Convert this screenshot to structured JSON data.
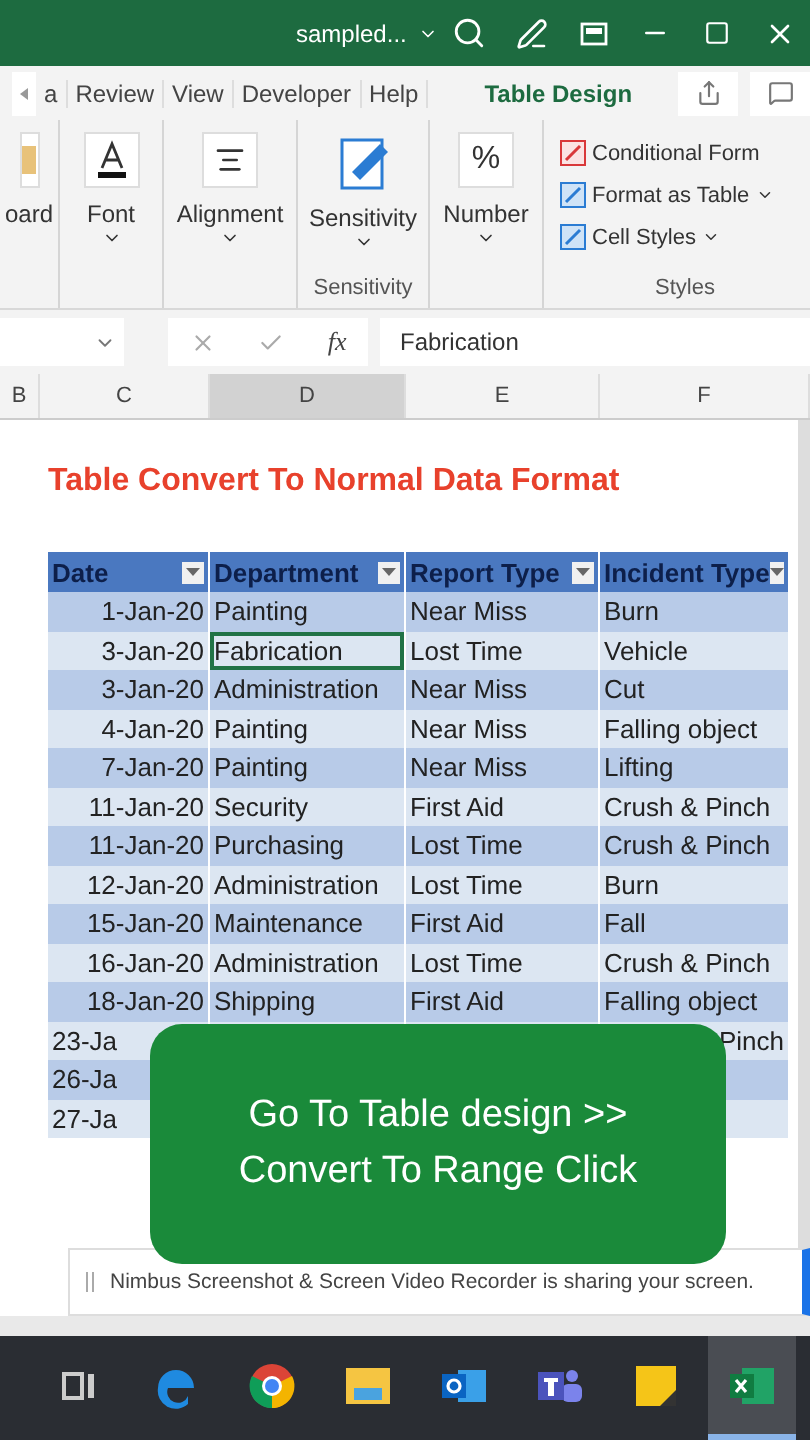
{
  "title_bar": {
    "file_name": "sampled..."
  },
  "ribbon_tabs": [
    {
      "label": "a",
      "selected": false
    },
    {
      "label": "Review",
      "selected": false
    },
    {
      "label": "View",
      "selected": false
    },
    {
      "label": "Developer",
      "selected": false
    },
    {
      "label": "Help",
      "selected": false
    },
    {
      "label": "Table Design",
      "selected": true
    }
  ],
  "ribbon": {
    "clipboard_label": "oard",
    "font_label": "Font",
    "alignment_label": "Alignment",
    "sensitivity_button": "Sensitivity",
    "sensitivity_group": "Sensitivity",
    "number_icon": "%",
    "number_label": "Number",
    "styles_items": [
      "Conditional Form",
      "Format as Table",
      "Cell Styles"
    ],
    "styles_group": "Styles"
  },
  "formula_bar": {
    "fx": "fx",
    "value": "Fabrication"
  },
  "column_headers": [
    {
      "label": "B",
      "selected": false
    },
    {
      "label": "C",
      "selected": false
    },
    {
      "label": "D",
      "selected": true
    },
    {
      "label": "E",
      "selected": false
    },
    {
      "label": "F",
      "selected": false
    }
  ],
  "sheet": {
    "heading": "Table Convert To Normal Data Format",
    "table": {
      "columns": [
        "Date",
        "Department",
        "Report Type",
        "Incident Type"
      ],
      "rows": [
        {
          "date": "1-Jan-20",
          "department": "Painting",
          "report_type": "Near Miss",
          "incident_type": "Burn",
          "selected": false
        },
        {
          "date": "3-Jan-20",
          "department": "Fabrication",
          "report_type": "Lost Time",
          "incident_type": "Vehicle",
          "selected": true
        },
        {
          "date": "3-Jan-20",
          "department": "Administration",
          "report_type": "Near Miss",
          "incident_type": "Cut",
          "selected": false
        },
        {
          "date": "4-Jan-20",
          "department": "Painting",
          "report_type": "Near Miss",
          "incident_type": "Falling object",
          "selected": false
        },
        {
          "date": "7-Jan-20",
          "department": "Painting",
          "report_type": "Near Miss",
          "incident_type": "Lifting",
          "selected": false
        },
        {
          "date": "11-Jan-20",
          "department": "Security",
          "report_type": "First Aid",
          "incident_type": "Crush & Pinch",
          "selected": false
        },
        {
          "date": "11-Jan-20",
          "department": "Purchasing",
          "report_type": "Lost Time",
          "incident_type": "Crush & Pinch",
          "selected": false
        },
        {
          "date": "12-Jan-20",
          "department": "Administration",
          "report_type": "Lost Time",
          "incident_type": "Burn",
          "selected": false
        },
        {
          "date": "15-Jan-20",
          "department": "Maintenance",
          "report_type": "First Aid",
          "incident_type": "Fall",
          "selected": false
        },
        {
          "date": "16-Jan-20",
          "department": "Administration",
          "report_type": "Lost Time",
          "incident_type": "Crush & Pinch",
          "selected": false
        },
        {
          "date": "18-Jan-20",
          "department": "Shipping",
          "report_type": "First Aid",
          "incident_type": "Falling object",
          "selected": false
        },
        {
          "date": "23-Ja",
          "incident_type": "Pinch"
        },
        {
          "date": "26-Ja"
        },
        {
          "date": "27-Ja"
        }
      ]
    }
  },
  "overlay": {
    "lines": [
      "Go To Table design >>",
      "Convert To Range Click"
    ]
  },
  "notification": {
    "text": "Nimbus Screenshot & Screen Video Recorder is sharing your screen."
  },
  "taskbar": {
    "apps": [
      {
        "kind": "taskview",
        "selected": false
      },
      {
        "kind": "edge",
        "selected": false
      },
      {
        "kind": "chrome",
        "selected": false
      },
      {
        "kind": "files",
        "selected": false
      },
      {
        "kind": "outlook",
        "selected": false
      },
      {
        "kind": "teams",
        "selected": false
      },
      {
        "kind": "notes",
        "selected": false
      },
      {
        "kind": "excel",
        "selected": true
      }
    ]
  }
}
